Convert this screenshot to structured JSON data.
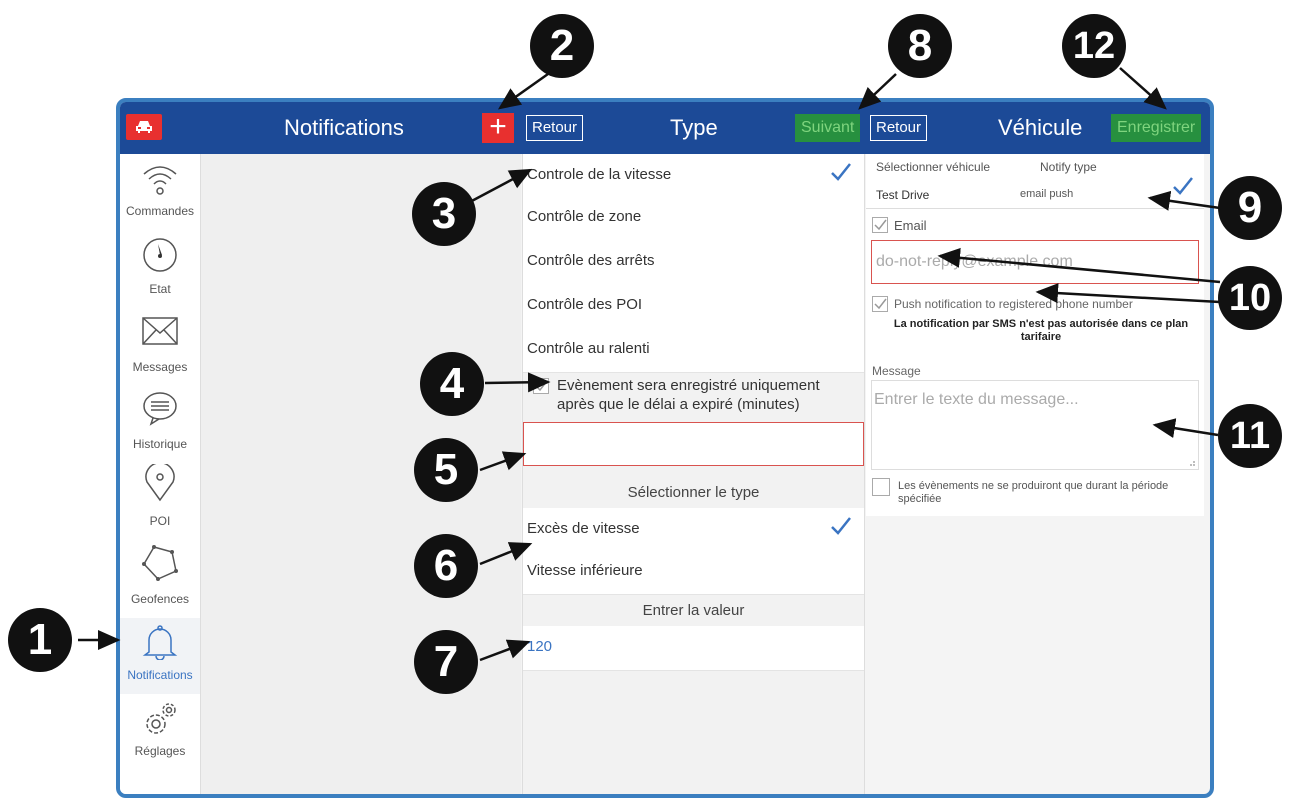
{
  "topbar": {
    "notifications_title": "Notifications",
    "plus_label": "+",
    "type_title": "Type",
    "retour_label_1": "Retour",
    "suivant_label": "Suivant",
    "retour_label_2": "Retour",
    "vehicule_title": "Véhicule",
    "enregistrer_label": "Enregistrer"
  },
  "sidebar": {
    "items": [
      {
        "label": "Commandes",
        "icon": "wifi-icon"
      },
      {
        "label": "Etat",
        "icon": "gauge-icon"
      },
      {
        "label": "Messages",
        "icon": "envelope-icon"
      },
      {
        "label": "Historique",
        "icon": "speech-bubble-icon"
      },
      {
        "label": "POI",
        "icon": "map-pin-icon"
      },
      {
        "label": "Geofences",
        "icon": "polygon-icon"
      },
      {
        "label": "Notifications",
        "icon": "bell-icon",
        "active": true
      },
      {
        "label": "Réglages",
        "icon": "gears-icon"
      }
    ]
  },
  "type_panel": {
    "controls": [
      {
        "label": "Controle de la vitesse",
        "selected": true
      },
      {
        "label": "Contrôle de zone"
      },
      {
        "label": "Contrôle des arrêts"
      },
      {
        "label": "Contrôle des POI"
      },
      {
        "label": "Contrôle au ralenti"
      }
    ],
    "delay_checkbox_label": "Evènement sera enregistré uniquement après que le délai a expiré (minutes)",
    "delay_value": "",
    "select_type_heading": "Sélectionner le type",
    "types": [
      {
        "label": "Excès de vitesse",
        "selected": true
      },
      {
        "label": "Vitesse inférieure"
      }
    ],
    "enter_value_heading": "Entrer la valeur",
    "value": "120"
  },
  "vehicle_panel": {
    "col_vehicle_header": "Sélectionner véhicule",
    "col_notify_header": "Notify type",
    "vehicle_name": "Test Drive",
    "notify_types": "email push",
    "email_checkbox_label": "Email",
    "email_value": "do-not-reply@example.com",
    "push_checkbox_label": "Push notification to registered phone number",
    "sms_warning": "La notification par SMS n'est pas autorisée dans ce plan tarifaire",
    "message_label": "Message",
    "message_placeholder": "Entrer le texte du message...",
    "period_checkbox_label": "Les évènements ne se produiront que durant la période spécifiée"
  },
  "callouts": [
    "1",
    "2",
    "3",
    "4",
    "5",
    "6",
    "7",
    "8",
    "9",
    "10",
    "11",
    "12"
  ],
  "colors": {
    "topbar": "#1c4a97",
    "accent_red": "#e8302f",
    "accent_green": "#27903f",
    "frame_border": "#3b7fc0",
    "check_blue": "#3a74c2"
  }
}
